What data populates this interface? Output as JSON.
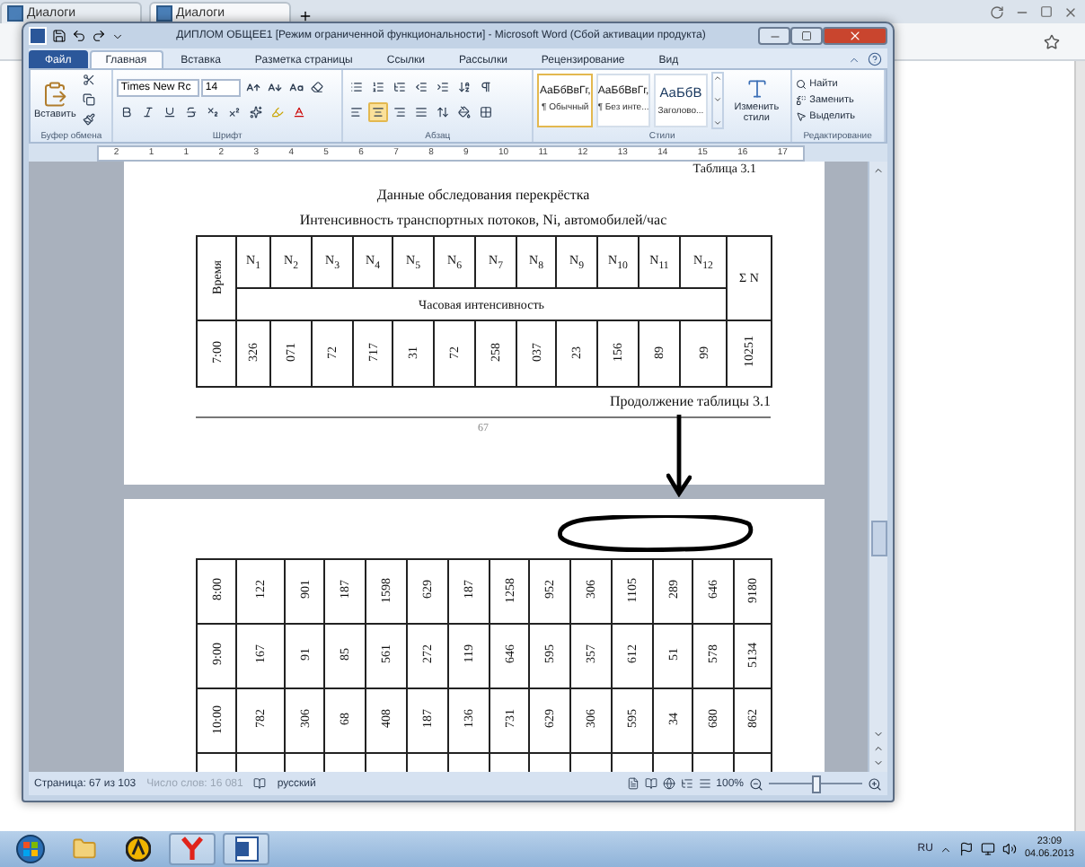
{
  "browser": {
    "tabs": [
      {
        "label": "Диалоги",
        "selected": false
      },
      {
        "label": "Диалоги",
        "selected": true
      }
    ]
  },
  "word": {
    "title": "ДИПЛОМ ОБЩЕЕ1 [Режим ограниченной функциональности] - Microsoft Word (Сбой активации продукта)",
    "tabs": [
      {
        "label": "Файл",
        "kind": "file",
        "selected": false
      },
      {
        "label": "Главная",
        "kind": "tab",
        "selected": true
      },
      {
        "label": "Вставка",
        "kind": "tab",
        "selected": false
      },
      {
        "label": "Разметка страницы",
        "kind": "tab",
        "selected": false
      },
      {
        "label": "Ссылки",
        "kind": "tab",
        "selected": false
      },
      {
        "label": "Рассылки",
        "kind": "tab",
        "selected": false
      },
      {
        "label": "Рецензирование",
        "kind": "tab",
        "selected": false
      },
      {
        "label": "Вид",
        "kind": "tab",
        "selected": false
      }
    ],
    "ribbon": {
      "paste": "Вставить",
      "font_name": "Times New Rc",
      "font_size": "14",
      "alignment": [
        {
          "kind": "left",
          "selected": false
        },
        {
          "kind": "center",
          "selected": true
        },
        {
          "kind": "right",
          "selected": false
        },
        {
          "kind": "justify",
          "selected": false
        }
      ],
      "styles": [
        {
          "sample": "АаБбВвГг,",
          "name": "¶ Обычный",
          "kind": "normal",
          "selected": true
        },
        {
          "sample": "АаБбВвГг,",
          "name": "¶ Без инте...",
          "kind": "normal",
          "selected": false
        },
        {
          "sample": "АаБбВ",
          "name": "Заголово...",
          "kind": "heading",
          "selected": false
        }
      ],
      "change_styles": "Изменить стили",
      "editing": [
        {
          "label": "Найти",
          "kind": "find"
        },
        {
          "label": "Заменить",
          "kind": "replace"
        },
        {
          "label": "Выделить",
          "kind": "select"
        }
      ],
      "groups": [
        "Буфер обмена",
        "Шрифт",
        "Абзац",
        "Стили",
        "Редактирование"
      ]
    },
    "ruler": [
      "2",
      "1",
      "1",
      "2",
      "3",
      "4",
      "5",
      "6",
      "7",
      "8",
      "9",
      "10",
      "11",
      "12",
      "13",
      "14",
      "15",
      "16",
      "17"
    ],
    "page1": {
      "caption": "Таблица 3.1",
      "title": "Данные обследования перекрёстка",
      "subtitle": "Интенсивность транспортных потоков, Ni, автомобилей/час",
      "table": {
        "time_header": "Время",
        "n_headers": [
          "N$_{1}$",
          "N$_{2}$",
          "N$_{3}$",
          "N$_{4}$",
          "N$_{5}$",
          "N$_{6}$",
          "N$_{7}$",
          "N$_{8}$",
          "N$_{9}$",
          "N$_{10}$",
          "N$_{11}$",
          "N$_{12}$"
        ],
        "sum_header": "Σ N",
        "subheader": "Часовая интенсивность",
        "rows": [
          {
            "time": "7:00",
            "values": [
              "326",
              "071",
              "72",
              "717",
              "31",
              "72",
              "258",
              "037",
              "23",
              "156",
              "89",
              "99",
              "10251"
            ]
          }
        ]
      },
      "continuation": "Продолжение таблицы 3.1",
      "page_number": "67"
    },
    "page2": {
      "rows": [
        {
          "time": "8:00",
          "values": [
            "122",
            "901",
            "187",
            "1598",
            "629",
            "187",
            "1258",
            "952",
            "306",
            "1105",
            "289",
            "646",
            "9180"
          ]
        },
        {
          "time": "9:00",
          "values": [
            "167",
            "91",
            "85",
            "561",
            "272",
            "119",
            "646",
            "595",
            "357",
            "612",
            "51",
            "578",
            "5134"
          ]
        },
        {
          "time": "10:00",
          "values": [
            "782",
            "306",
            "68",
            "408",
            "187",
            "136",
            "731",
            "629",
            "306",
            "595",
            "34",
            "680",
            "862"
          ]
        }
      ]
    },
    "status_bar": {
      "page": "Страница: 67 из 103",
      "words": "Число слов: 16 081",
      "language": "русский",
      "zoom": "100%",
      "zoom_slider": {
        "level": 0.5
      }
    }
  },
  "taskbar": {
    "language": "RU",
    "time": "23:09",
    "date": "04.06.2013"
  }
}
